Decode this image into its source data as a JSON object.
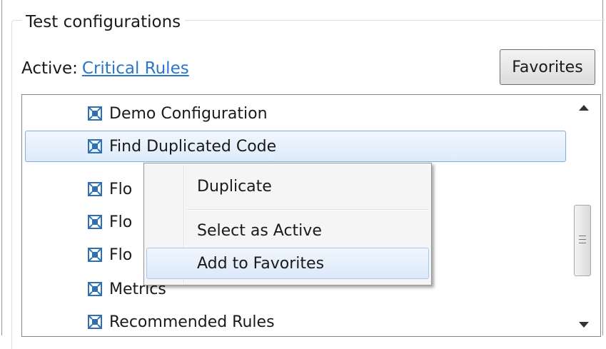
{
  "group": {
    "title": "Test configurations"
  },
  "active": {
    "label": "Active:",
    "link": "Critical Rules"
  },
  "favorites_button": "Favorites",
  "list": {
    "items": [
      {
        "label": "Demo Configuration",
        "selected": false
      },
      {
        "label": "Find Duplicated Code",
        "selected": true
      },
      {
        "label": "Flo",
        "selected": false
      },
      {
        "label": "Flo",
        "selected": false
      },
      {
        "label": "Flo",
        "selected": false
      },
      {
        "label": "Metrics",
        "selected": false
      },
      {
        "label": "Recommended Rules",
        "selected": false
      }
    ],
    "icon": "configuration-icon"
  },
  "context_menu": {
    "items": [
      {
        "label": "Duplicate",
        "highlighted": false
      },
      {
        "label": "Select as Active",
        "highlighted": false
      },
      {
        "label": "Add to Favorites",
        "highlighted": true
      }
    ]
  },
  "colors": {
    "link": "#2a76c8",
    "selection_border": "#84acdd",
    "icon": "#2f6fb3"
  }
}
